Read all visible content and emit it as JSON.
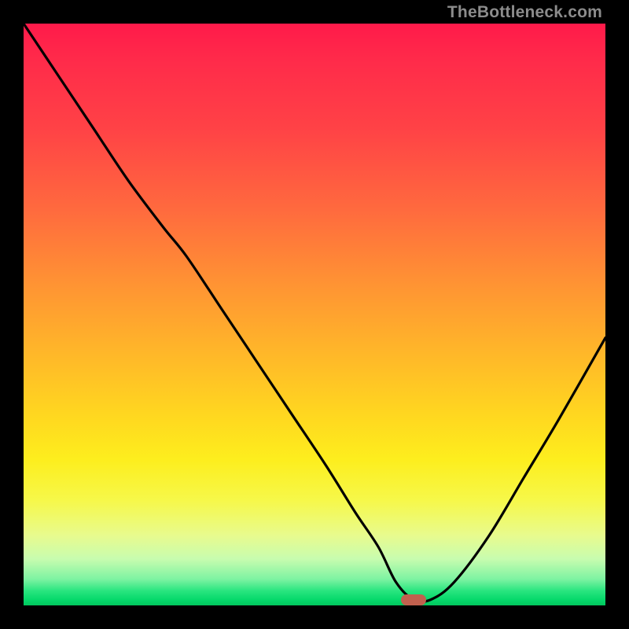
{
  "watermark": "TheBottleneck.com",
  "marker": {
    "x_pct": 67,
    "y_pct": 99
  },
  "chart_data": {
    "type": "line",
    "title": "",
    "xlabel": "",
    "ylabel": "",
    "xlim": [
      0,
      100
    ],
    "ylim": [
      0,
      100
    ],
    "grid": false,
    "legend": false,
    "series": [
      {
        "name": "bottleneck-curve",
        "x": [
          0,
          6,
          12,
          18,
          24,
          28,
          34,
          40,
          46,
          52,
          57,
          61,
          64,
          67,
          70,
          74,
          80,
          86,
          92,
          100
        ],
        "y": [
          100,
          91,
          82,
          73,
          65,
          60,
          51,
          42,
          33,
          24,
          16,
          10,
          4,
          1,
          1,
          4,
          12,
          22,
          32,
          46
        ]
      }
    ],
    "annotations": [
      {
        "type": "marker",
        "x": 67,
        "y": 1,
        "label": "optimal-point"
      }
    ],
    "background_gradient": {
      "orientation": "vertical",
      "stops": [
        {
          "pct": 0,
          "color": "#ff1a4a"
        },
        {
          "pct": 50,
          "color": "#ffae2b"
        },
        {
          "pct": 80,
          "color": "#fdf23a"
        },
        {
          "pct": 100,
          "color": "#02c75e"
        }
      ]
    }
  }
}
